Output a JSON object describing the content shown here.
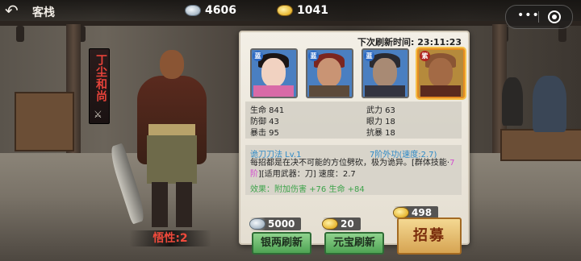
{
  "header": {
    "back_glyph": "↶",
    "title": "客栈"
  },
  "resources": {
    "silver": "4606",
    "gold": "1041"
  },
  "hero": {
    "name": "丁尘和尚",
    "aptitude": "悟性:2"
  },
  "panel": {
    "refresh_label": "下次刷新时间: 23:11:23",
    "candidates": [
      {
        "badge": "蓝",
        "selected": false
      },
      {
        "badge": "蓝",
        "selected": false
      },
      {
        "badge": "蓝",
        "selected": false
      },
      {
        "badge": "紫",
        "selected": true
      }
    ],
    "stats": {
      "hp": "生命 841",
      "martial": "武力 63",
      "defense": "防御 43",
      "insight": "眼力 18",
      "crit": "暴击 95",
      "anti_crit": "抗暴 18"
    },
    "skill": {
      "name": "诡刀刀法  Lv.1",
      "type": "7阶外功(速度:2.7)",
      "desc_a": "每招都是在决不可能的方位劈砍，极为诡异。[群体技能·",
      "desc_tier": "7阶",
      "desc_b": "][适用武器：刀] 速度：2.7",
      "effect": "效果：附加伤害 +76  生命 +84"
    }
  },
  "actions": {
    "silver_cost": "5000",
    "silver_refresh": "银两刷新",
    "gold_cost": "20",
    "gold_refresh": "元宝刷新",
    "recruit_cost": "498",
    "recruit": "招募"
  },
  "colors": {
    "accent_red": "#e8433a",
    "skill_blue": "#2f8ac7",
    "effect_green": "#3da34a",
    "tier_pink": "#d34bcf"
  }
}
